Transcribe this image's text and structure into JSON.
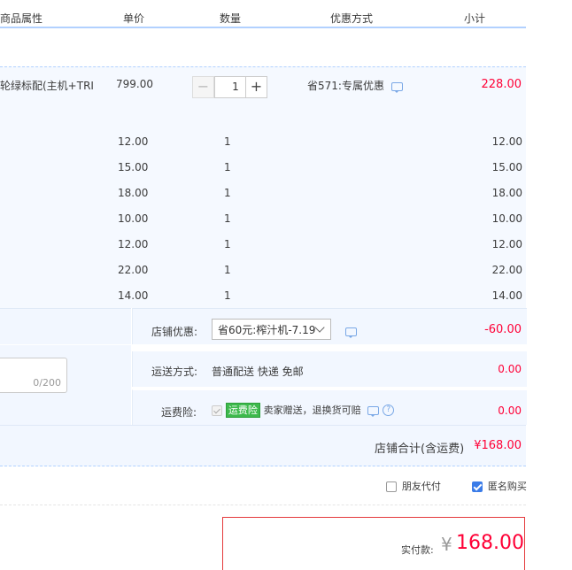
{
  "header": {
    "col_attr": "商品属性",
    "col_price": "单价",
    "col_qty": "数量",
    "col_promo": "优惠方式",
    "col_subtotal": "小计"
  },
  "main_item": {
    "name": "轮绿标配(主机+TRI",
    "price": "799.00",
    "quantity": "1",
    "minus": "−",
    "plus": "+",
    "promo": "省571:专属优惠",
    "subtotal": "228.00"
  },
  "items": [
    {
      "price": "12.00",
      "qty": "1",
      "subtotal": "12.00"
    },
    {
      "price": "15.00",
      "qty": "1",
      "subtotal": "15.00"
    },
    {
      "price": "18.00",
      "qty": "1",
      "subtotal": "18.00"
    },
    {
      "price": "10.00",
      "qty": "1",
      "subtotal": "10.00"
    },
    {
      "price": "12.00",
      "qty": "1",
      "subtotal": "12.00"
    },
    {
      "price": "22.00",
      "qty": "1",
      "subtotal": "22.00"
    },
    {
      "price": "14.00",
      "qty": "1",
      "subtotal": "14.00"
    }
  ],
  "shop": {
    "discount_label": "店铺优惠:",
    "discount_select": "省60元:榨汁机-7.19",
    "discount_amount": "-60.00",
    "shipping_label": "运送方式:",
    "shipping_value": "普通配送 快递 免邮",
    "shipping_amount": "0.00",
    "insurance_label": "运费险:",
    "insurance_tag": "运费险",
    "insurance_text": "卖家赠送，退换货可赔",
    "insurance_amount": "0.00",
    "message_counter": "0/200",
    "total_label": "店铺合计(含运费)",
    "total_value": "¥168.00"
  },
  "options": {
    "friend_pay": "朋友代付",
    "anonymous": "匿名购买"
  },
  "payment": {
    "label": "实付款:",
    "currency": "¥",
    "amount": "168.00"
  },
  "colors": {
    "accent_red": "#ff0036",
    "header_border": "#b2d1ff",
    "row_bg": "#f5f9ff"
  }
}
